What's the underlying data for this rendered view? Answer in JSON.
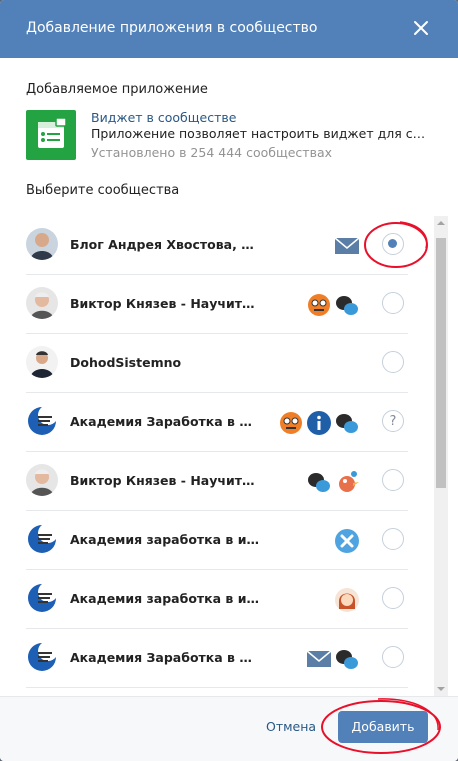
{
  "dialog": {
    "title": "Добавление приложения в сообщество"
  },
  "app": {
    "section_label": "Добавляемое приложение",
    "name": "Виджет в сообществе",
    "description": "Приложение позволяет настроить виджет для сообщества",
    "installs": "Установлено в 254 444 сообществах",
    "icon": "widget-icon"
  },
  "communities": {
    "section_label": "Выберите сообщества",
    "items": [
      {
        "name": "Блог Андрея Хвостова, заработок в интернете",
        "widgets": [
          "envelope-icon"
        ],
        "selection": "selected"
      },
      {
        "name": "Виктор Князев - Научитесь зарабатывать",
        "widgets": [
          "robot-app-icon",
          "chat-bubbles-icon"
        ],
        "selection": "unselected"
      },
      {
        "name": "DohodSistemno",
        "widgets": [],
        "selection": "unselected"
      },
      {
        "name": "Академия Заработка в Интернете",
        "widgets": [
          "robot-app-icon",
          "info-icon",
          "chat-bubbles-icon"
        ],
        "selection": "help"
      },
      {
        "name": "Виктор Князев - Научитесь зарабатывать",
        "widgets": [
          "chat-bubbles-icon",
          "bird-app-icon"
        ],
        "selection": "unselected"
      },
      {
        "name": "Академия заработка в интернете",
        "widgets": [
          "close-badge-icon"
        ],
        "selection": "unselected"
      },
      {
        "name": "Академия заработка в интернете",
        "widgets": [
          "girl-avatar-icon"
        ],
        "selection": "unselected"
      },
      {
        "name": "Академия Заработка в Интернете",
        "widgets": [
          "envelope-icon",
          "chat-bubbles-icon"
        ],
        "selection": "unselected"
      }
    ]
  },
  "footer": {
    "cancel_label": "Отмена",
    "add_label": "Добавить"
  },
  "colors": {
    "header": "#5181b8",
    "accent": "#5181b8",
    "annotation": "#e8102a",
    "app_icon": "#23a342"
  }
}
